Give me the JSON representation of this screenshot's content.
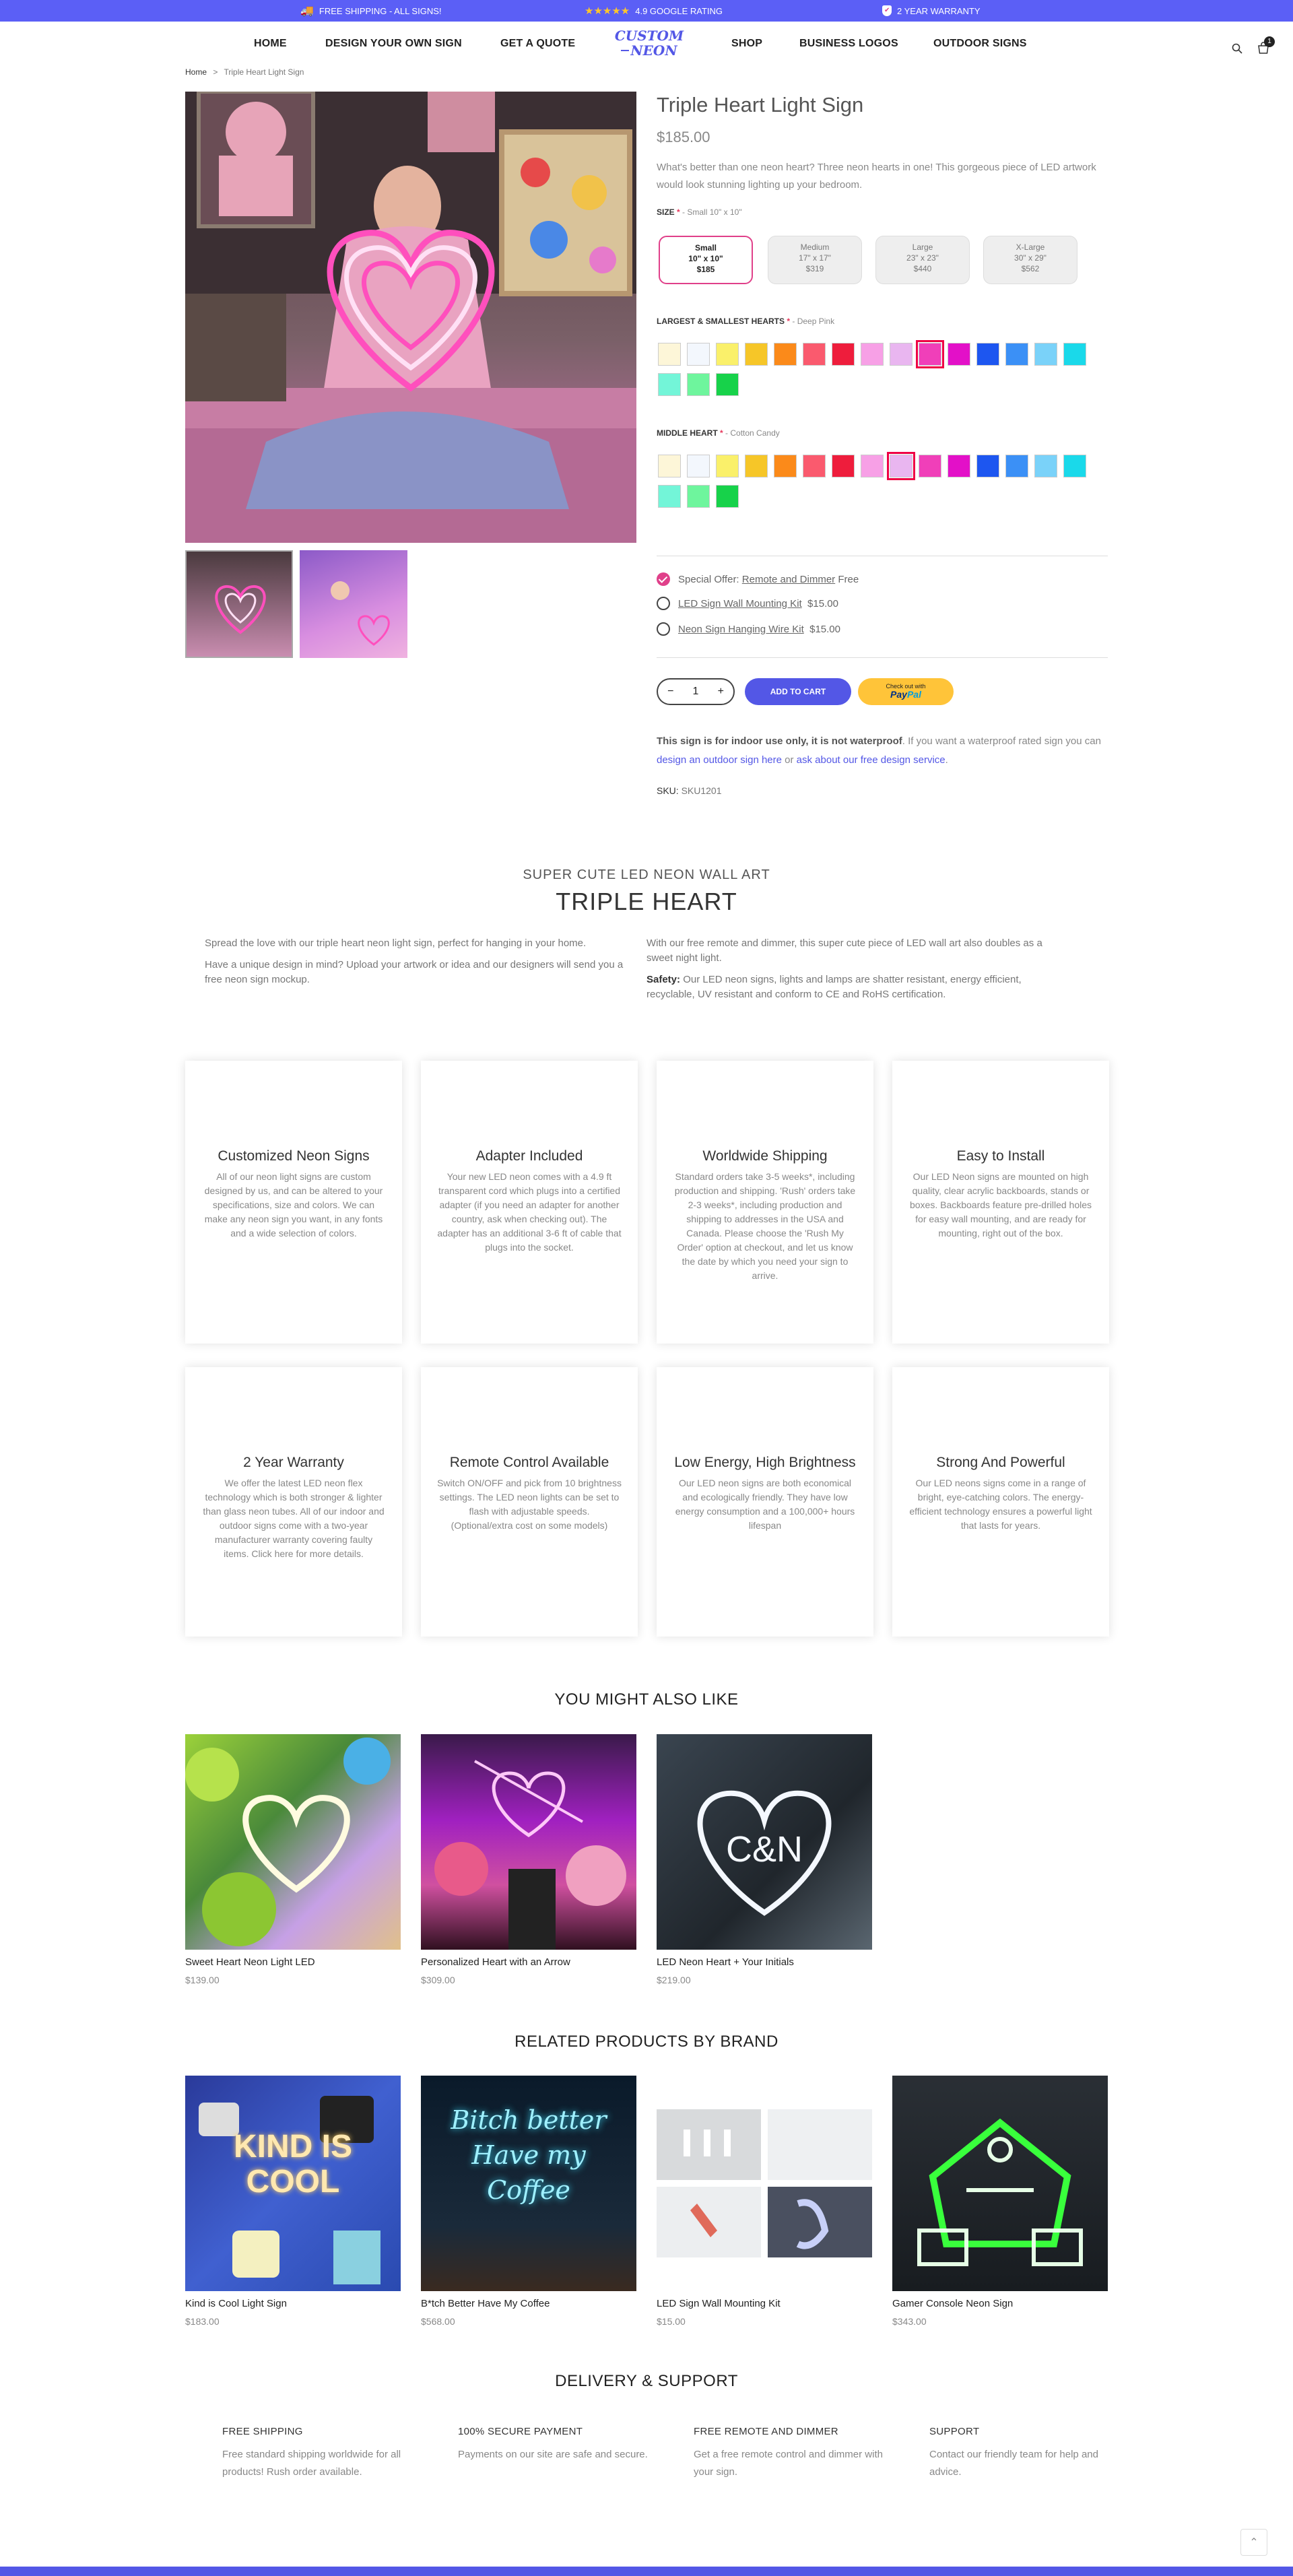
{
  "topbar": {
    "shipping": "FREE SHIPPING - ALL SIGNS!",
    "rating": "4.9 GOOGLE RATING",
    "warranty": "2 YEAR WARRANTY",
    "stars": "★★★★★"
  },
  "nav": {
    "items": [
      "HOME",
      "DESIGN YOUR OWN SIGN",
      "GET A QUOTE",
      "SHOP",
      "BUSINESS LOGOS",
      "OUTDOOR SIGNS"
    ],
    "logo_line1": "CUSTOM",
    "logo_line2": "NEON",
    "cart_count": "1"
  },
  "breadcrumb": {
    "home": "Home",
    "sep": ">",
    "current": "Triple Heart Light Sign"
  },
  "product": {
    "title": "Triple Heart Light Sign",
    "price": "$185.00",
    "description": "What's better than one neon heart? Three neon hearts in one! This gorgeous piece of LED artwork would look stunning lighting up your bedroom.",
    "size_label": "SIZE",
    "size_value": "- Small 10\" x 10\"",
    "sizes": [
      {
        "name": "Small",
        "dims": "10\" x 10\"",
        "price": "$185"
      },
      {
        "name": "Medium",
        "dims": "17\" x 17\"",
        "price": "$319"
      },
      {
        "name": "Large",
        "dims": "23\" x 23\"",
        "price": "$440"
      },
      {
        "name": "X-Large",
        "dims": "30\" x 29\"",
        "price": "$562"
      }
    ],
    "hearts_label": "LARGEST & SMALLEST HEARTS",
    "hearts_value": "- Deep Pink",
    "middle_label": "MIDDLE HEART",
    "middle_value": "- Cotton Candy",
    "swatches": [
      "#fdf6d8",
      "#f3f7fd",
      "#faf06a",
      "#f6c628",
      "#fb8a1a",
      "#fa5a6e",
      "#ee1d3c",
      "#f7a0e6",
      "#e9b6f0",
      "#f03fb9",
      "#e310c8",
      "#1d56f0",
      "#3b90f6",
      "#7ad2f9",
      "#1ad9ea",
      "#73f5d8",
      "#6ef59d",
      "#17d24a"
    ],
    "special_offer_prefix": "Special Offer:",
    "special_offer_link": "Remote and Dimmer",
    "special_offer_suffix": "Free",
    "addons": [
      {
        "name": "LED Sign Wall Mounting Kit",
        "price": "$15.00"
      },
      {
        "name": "Neon Sign Hanging Wire Kit",
        "price": "$15.00"
      }
    ],
    "qty": "1",
    "add_to_cart": "ADD TO CART",
    "paypal_top": "Check out with",
    "paypal_brand_a": "Pay",
    "paypal_brand_b": "Pal",
    "note_bold": "This sign is for indoor use only, it is not waterproof",
    "note_text": ". If you want a waterproof rated sign you can ",
    "note_link1": "design an outdoor sign here",
    "note_or": " or ",
    "note_link2": "ask about our free design service",
    "note_end": ".",
    "sku_label": "SKU:",
    "sku": "SKU1201"
  },
  "about": {
    "subtitle": "SUPER CUTE LED NEON WALL ART",
    "title": "TRIPLE HEART",
    "left_p1": "Spread the love with our triple heart neon light sign, perfect for hanging in your home.",
    "left_p2": "Have a unique design in mind? Upload your artwork or idea and our designers will send you a free neon sign mockup.",
    "right_p1": "With our free remote and dimmer, this super cute piece of LED wall art also doubles as a sweet night light.",
    "right_p2_bold": "Safety:",
    "right_p2": " Our LED neon signs, lights and lamps are shatter resistant, energy efficient, recyclable, UV resistant and conform to CE and RoHS certification."
  },
  "features": [
    {
      "title": "Customized Neon Signs",
      "text": "All of our neon light signs are custom designed by us, and can be altered to your specifications, size and colors. We can make any neon sign you want, in any fonts and a wide selection of colors."
    },
    {
      "title": "Adapter Included",
      "text": "Your new LED neon comes with a 4.9 ft transparent cord which plugs into a certified adapter (if you need an adapter for another country, ask when checking out). The adapter has an additional 3-6 ft of cable that plugs into the socket."
    },
    {
      "title": "Worldwide Shipping",
      "text": "Standard orders take 3-5 weeks*, including production and shipping. 'Rush' orders take 2-3 weeks*, including production and shipping to addresses in the USA and Canada. Please choose the 'Rush My Order' option at checkout, and let us know the date by which you need your sign to arrive."
    },
    {
      "title": "Easy to Install",
      "text": "Our LED Neon signs are mounted on high quality, clear acrylic backboards, stands or boxes. Backboards feature pre-drilled holes for easy wall mounting, and are ready for mounting, right out of the box."
    },
    {
      "title": "2 Year Warranty",
      "text": "We offer the latest LED neon flex technology which is both stronger & lighter than glass neon tubes. All of our indoor and outdoor signs come with a two-year manufacturer warranty covering faulty items. Click here for more details."
    },
    {
      "title": "Remote Control Available",
      "text": "Switch ON/OFF and pick from 10 brightness settings. The LED neon lights can be set to flash with adjustable speeds. (Optional/extra cost on some models)"
    },
    {
      "title": "Low Energy, High Brightness",
      "text": "Our LED neon signs are both economical and ecologically friendly. They have low energy consumption and a 100,000+ hours lifespan"
    },
    {
      "title": "Strong And Powerful",
      "text": "Our LED neons signs come in a range of bright, eye-catching colors. The energy-efficient technology ensures a powerful light that lasts for years."
    }
  ],
  "also_like": {
    "title": "YOU MIGHT ALSO LIKE",
    "items": [
      {
        "name": "Sweet Heart Neon Light LED",
        "price": "$139.00"
      },
      {
        "name": "Personalized Heart with an Arrow",
        "price": "$309.00"
      },
      {
        "name": "LED Neon Heart + Your Initials",
        "price": "$219.00",
        "img_text": "C&N"
      }
    ]
  },
  "related": {
    "title": "RELATED PRODUCTS BY BRAND",
    "items": [
      {
        "name": "Kind is Cool Light Sign",
        "price": "$183.00",
        "img_text": "KIND IS COOL"
      },
      {
        "name": "B*tch Better Have My Coffee",
        "price": "$568.00",
        "img_text": "Bitch better Have my Coffee"
      },
      {
        "name": "LED Sign Wall Mounting Kit",
        "price": "$15.00"
      },
      {
        "name": "Gamer Console Neon Sign",
        "price": "$343.00"
      }
    ]
  },
  "support": {
    "title": "DELIVERY & SUPPORT",
    "items": [
      {
        "title": "FREE SHIPPING",
        "text": "Free standard shipping worldwide for all products! Rush order available."
      },
      {
        "title": "100% SECURE PAYMENT",
        "text": "Payments on our site are safe and secure."
      },
      {
        "title": "FREE REMOTE AND DIMMER",
        "text": "Get a free remote control and dimmer with your sign."
      },
      {
        "title": "SUPPORT",
        "text": "Contact our friendly team for help and advice."
      }
    ]
  }
}
